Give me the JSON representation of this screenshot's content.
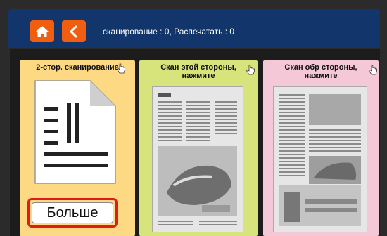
{
  "header": {
    "home_icon": "home-icon",
    "back_icon": "chevron-left-icon",
    "status_text": "сканирование : 0, Распечатать : 0"
  },
  "cards": [
    {
      "title": "2-стор. сканирование",
      "icon": "document-icon",
      "color": "#fcd982"
    },
    {
      "title_line1": "Скан этой стороны,",
      "title_line2": "нажмите",
      "color": "#d7e37b"
    },
    {
      "title_line1": "Скан обр стороны,",
      "title_line2": "нажмите",
      "color": "#f5c8d7"
    }
  ],
  "more_button": {
    "label": "Больше"
  },
  "colors": {
    "accent": "#f25e0f",
    "header": "#12366b",
    "highlight": "#e01b1b"
  }
}
